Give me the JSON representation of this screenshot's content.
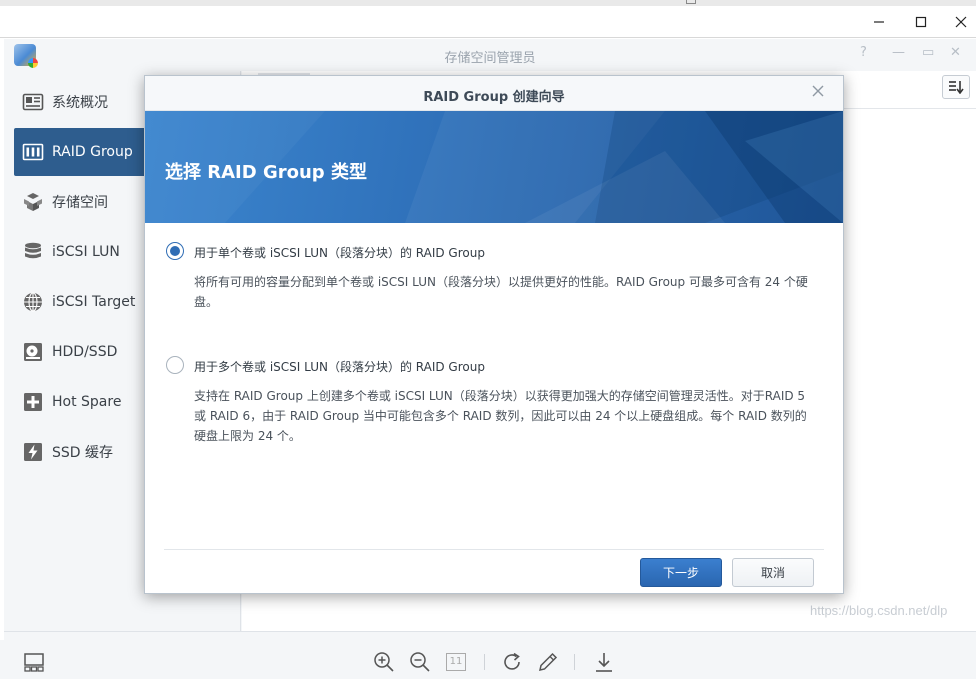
{
  "app": {
    "title": "存储空间管理员"
  },
  "sidebar": {
    "items": [
      {
        "label": "系统概况",
        "icon": "overview-icon",
        "active": false
      },
      {
        "label": "RAID Group",
        "icon": "raid-group-icon",
        "active": true
      },
      {
        "label": "存储空间",
        "icon": "volume-icon",
        "active": false
      },
      {
        "label": "iSCSI LUN",
        "icon": "iscsi-lun-icon",
        "active": false
      },
      {
        "label": "iSCSI Target",
        "icon": "iscsi-target-icon",
        "active": false
      },
      {
        "label": "HDD/SSD",
        "icon": "hdd-icon",
        "active": false
      },
      {
        "label": "Hot Spare",
        "icon": "hot-spare-icon",
        "active": false
      },
      {
        "label": "SSD 缓存",
        "icon": "ssd-cache-icon",
        "active": false
      }
    ]
  },
  "dialog": {
    "title": "RAID Group 创建向导",
    "heading": "选择 RAID Group 类型",
    "options": [
      {
        "label": "用于单个卷或 iSCSI LUN（段落分块）的 RAID Group",
        "description": "将所有可用的容量分配到单个卷或 iSCSI LUN（段落分块）以提供更好的性能。RAID Group 可最多可含有 24 个硬盘。",
        "selected": true
      },
      {
        "label": "用于多个卷或 iSCSI LUN（段落分块）的 RAID Group",
        "description": "支持在 RAID Group 上创建多个卷或 iSCSI LUN（段落分块）以获得更加强大的存储空间管理灵活性。对于RAID 5 或 RAID 6，由于 RAID Group 当中可能包含多个 RAID 数列，因此可以由 24 个以上硬盘组成。每个 RAID 数列的硬盘上限为 24 个。",
        "selected": false
      }
    ],
    "buttons": {
      "next": "下一步",
      "cancel": "取消"
    }
  },
  "viewer_toolbar": {
    "page_box": "11"
  },
  "watermark": "https://blog.csdn.net/dlp",
  "colors": {
    "accent": "#2e5d8e",
    "banner": "#2e6fb8",
    "primary_button": "#2f6db5"
  }
}
